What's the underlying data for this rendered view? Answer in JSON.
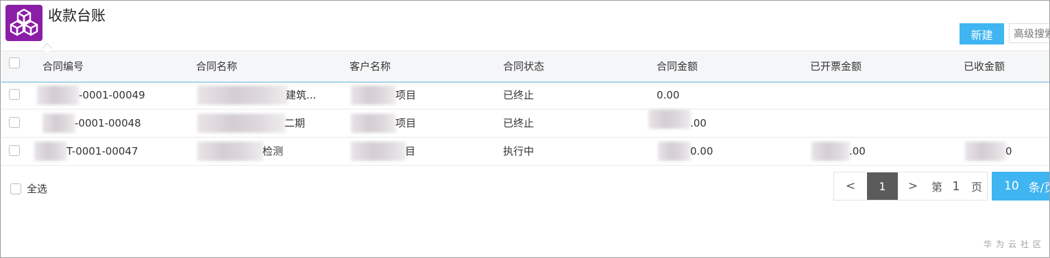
{
  "header": {
    "title": "收款台账",
    "new_button": "新建",
    "advanced_search": "高级搜索",
    "app_icon": "cubes-icon"
  },
  "table": {
    "columns": [
      "合同编号",
      "合同名称",
      "客户名称",
      "合同状态",
      "合同金额",
      "已开票金额",
      "已收金额"
    ],
    "rows": [
      {
        "code": "-0001-00049",
        "name": "建筑...",
        "customer": "项目",
        "status": "已终止",
        "amount": "0.00",
        "invoiced": "",
        "received": ""
      },
      {
        "code": "-0001-00048",
        "name": "二期",
        "customer": "项目",
        "status": "已终止",
        "amount": ".00",
        "invoiced": "",
        "received": ""
      },
      {
        "code": "T-0001-00047",
        "name": "检测",
        "customer": "目",
        "status": "执行中",
        "amount": "0.00",
        "invoiced": ".00",
        "received": "0"
      }
    ]
  },
  "footer": {
    "select_all": "全选",
    "pager": {
      "prev": "<",
      "current": "1",
      "next": ">",
      "page_prefix": "第",
      "page_value": "1",
      "page_suffix": "页",
      "page_size": "10",
      "page_size_unit": "条/页"
    }
  },
  "watermark": "华为云社区",
  "colors": {
    "accent": "#3fb5f2",
    "brand": "#8b1ea6",
    "current_page": "#5b5b5b"
  }
}
